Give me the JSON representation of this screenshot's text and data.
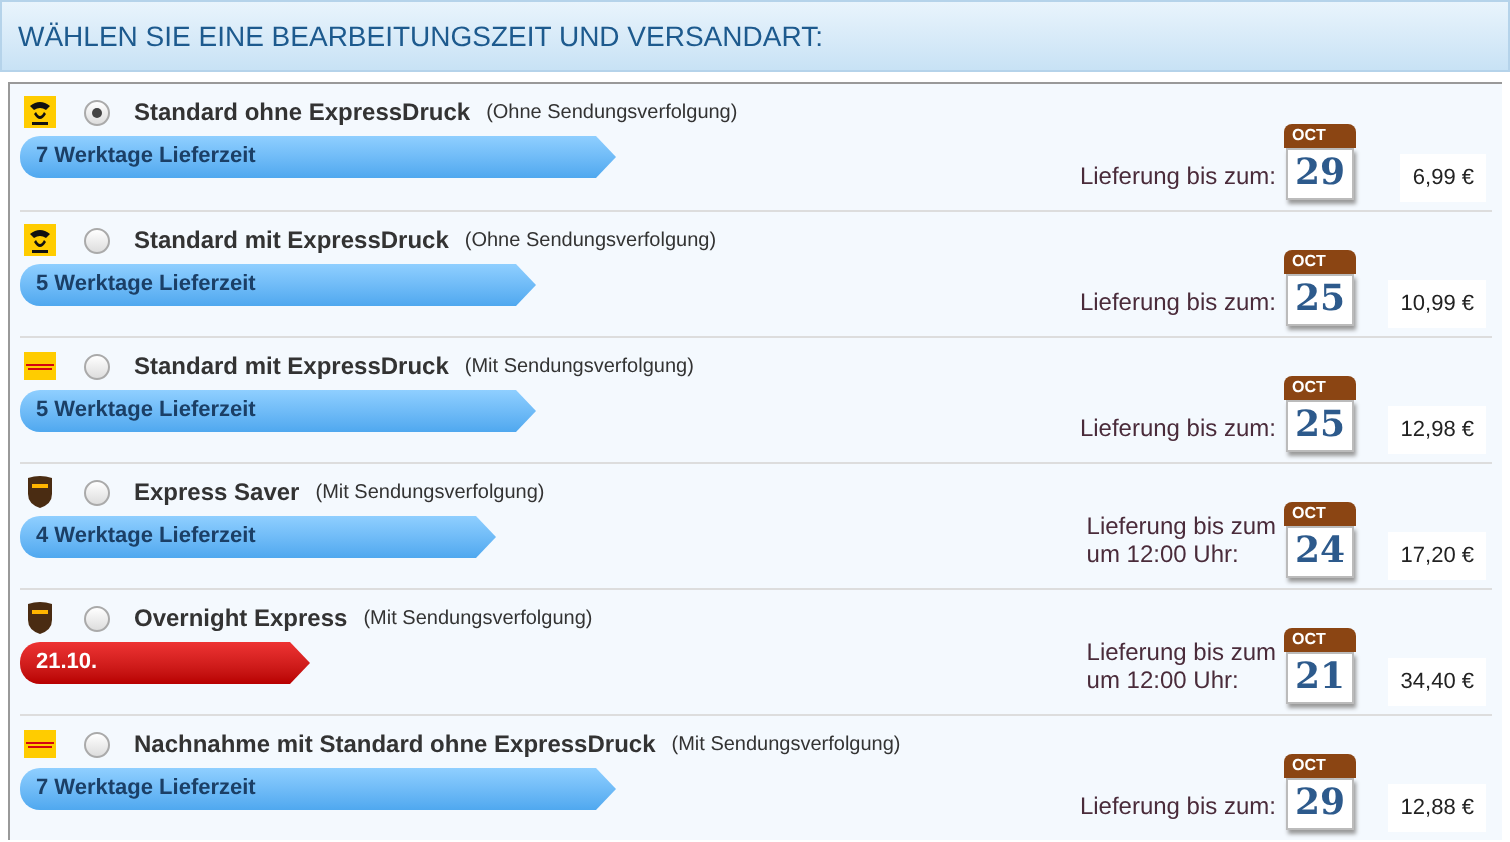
{
  "header": {
    "title": "WÄHLEN SIE EINE BEARBEITUNGSZEIT UND VERSANDART:"
  },
  "options": [
    {
      "kind": "post",
      "selected": true,
      "name": "Standard ohne ExpressDruck",
      "note": "(Ohne Sendungsverfolgung)",
      "bar": {
        "kind": "long",
        "text": "7 Werktage Lieferzeit"
      },
      "delivery": [
        "Lieferung bis zum:"
      ],
      "month": "OCT",
      "day": "29",
      "price": "6,99 €"
    },
    {
      "kind": "post",
      "selected": false,
      "name": "Standard mit ExpressDruck",
      "note": "(Ohne Sendungsverfolgung)",
      "bar": {
        "kind": "medium",
        "text": "5 Werktage Lieferzeit"
      },
      "delivery": [
        "Lieferung bis zum:"
      ],
      "month": "OCT",
      "day": "25",
      "price": "10,99 €"
    },
    {
      "kind": "dhl",
      "selected": false,
      "name": "Standard mit ExpressDruck",
      "note": "(Mit Sendungsverfolgung)",
      "bar": {
        "kind": "medium",
        "text": "5 Werktage Lieferzeit"
      },
      "delivery": [
        "Lieferung bis zum:"
      ],
      "month": "OCT",
      "day": "25",
      "price": "12,98 €"
    },
    {
      "kind": "ups",
      "selected": false,
      "name": "Express Saver",
      "note": "(Mit Sendungsverfolgung)",
      "bar": {
        "kind": "short",
        "text": "4 Werktage Lieferzeit"
      },
      "delivery": [
        "Lieferung bis zum",
        "um 12:00 Uhr:"
      ],
      "month": "OCT",
      "day": "24",
      "price": "17,20 €"
    },
    {
      "kind": "ups",
      "selected": false,
      "name": "Overnight Express",
      "note": "(Mit Sendungsverfolgung)",
      "bar": {
        "kind": "date",
        "text": "21.10."
      },
      "delivery": [
        "Lieferung bis zum",
        "um 12:00 Uhr:"
      ],
      "month": "OCT",
      "day": "21",
      "price": "34,40 €"
    },
    {
      "kind": "dhl",
      "selected": false,
      "name": "Nachnahme mit Standard ohne ExpressDruck",
      "note": "(Mit Sendungsverfolgung)",
      "bar": {
        "kind": "long",
        "text": "7 Werktage Lieferzeit"
      },
      "delivery": [
        "Lieferung bis zum:"
      ],
      "month": "OCT",
      "day": "29",
      "price": "12,88 €"
    }
  ]
}
